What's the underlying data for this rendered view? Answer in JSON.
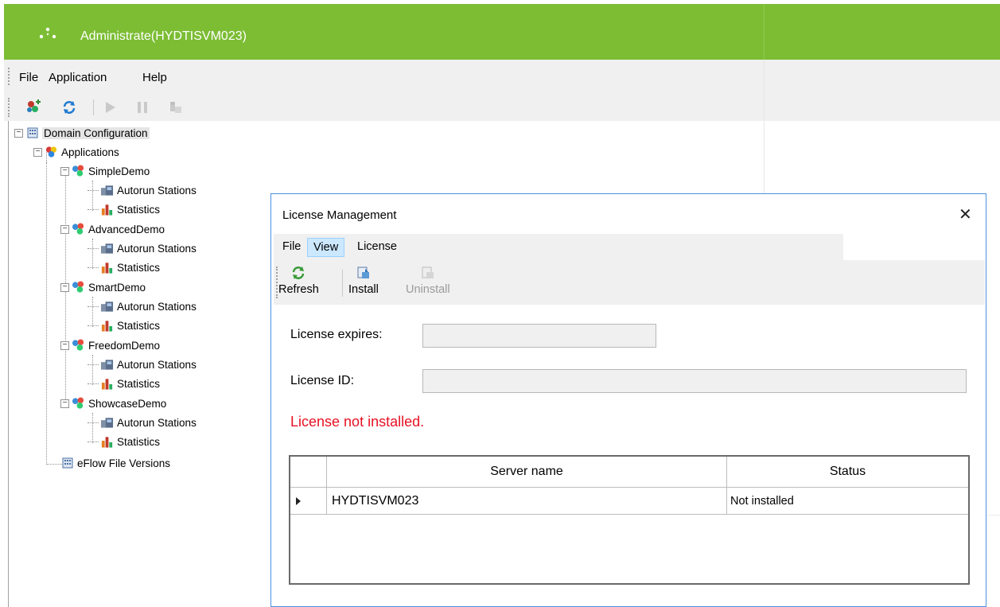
{
  "window": {
    "title": "Administrate(HYDTISVM023)",
    "accent_color": "#7cbd34",
    "icon": "app-logo-icon"
  },
  "menubar": {
    "items": [
      "File",
      "Application",
      "Help"
    ]
  },
  "toolbar": {
    "buttons": [
      {
        "name": "add-application-icon",
        "enabled": true
      },
      {
        "name": "refresh-icon",
        "enabled": true
      },
      {
        "name": "start-icon",
        "enabled": false
      },
      {
        "name": "pause-icon",
        "enabled": false
      },
      {
        "name": "stop-station-icon",
        "enabled": false
      }
    ]
  },
  "tree": {
    "root": "Domain Configuration",
    "applications_label": "Applications",
    "apps": [
      {
        "name": "SimpleDemo",
        "children": [
          "Autorun Stations",
          "Statistics"
        ]
      },
      {
        "name": "AdvancedDemo",
        "children": [
          "Autorun Stations",
          "Statistics"
        ]
      },
      {
        "name": "SmartDemo",
        "children": [
          "Autorun Stations",
          "Statistics"
        ]
      },
      {
        "name": "FreedomDemo",
        "children": [
          "Autorun Stations",
          "Statistics"
        ]
      },
      {
        "name": "ShowcaseDemo",
        "children": [
          "Autorun Stations",
          "Statistics"
        ]
      }
    ],
    "file_versions": "eFlow File Versions"
  },
  "dialog": {
    "title": "License Management",
    "close_glyph": "✕",
    "menu": [
      {
        "label": "File",
        "active": false
      },
      {
        "label": "View",
        "active": true
      },
      {
        "label": "License",
        "active": false
      }
    ],
    "toolbar": [
      {
        "label": "Refresh",
        "icon": "refresh-icon",
        "enabled": true
      },
      {
        "label": "Install",
        "icon": "install-icon",
        "enabled": true
      },
      {
        "label": "Uninstall",
        "icon": "uninstall-icon",
        "enabled": false
      }
    ],
    "license_expires_label": "License expires:",
    "license_expires_value": "",
    "license_id_label": "License ID:",
    "license_id_value": "",
    "error_message": "License not installed.",
    "error_color": "#e81123",
    "grid": {
      "columns": [
        "Server name",
        "Status"
      ],
      "rows": [
        {
          "server": "HYDTISVM023",
          "status": "Not installed",
          "current": true
        }
      ]
    }
  }
}
